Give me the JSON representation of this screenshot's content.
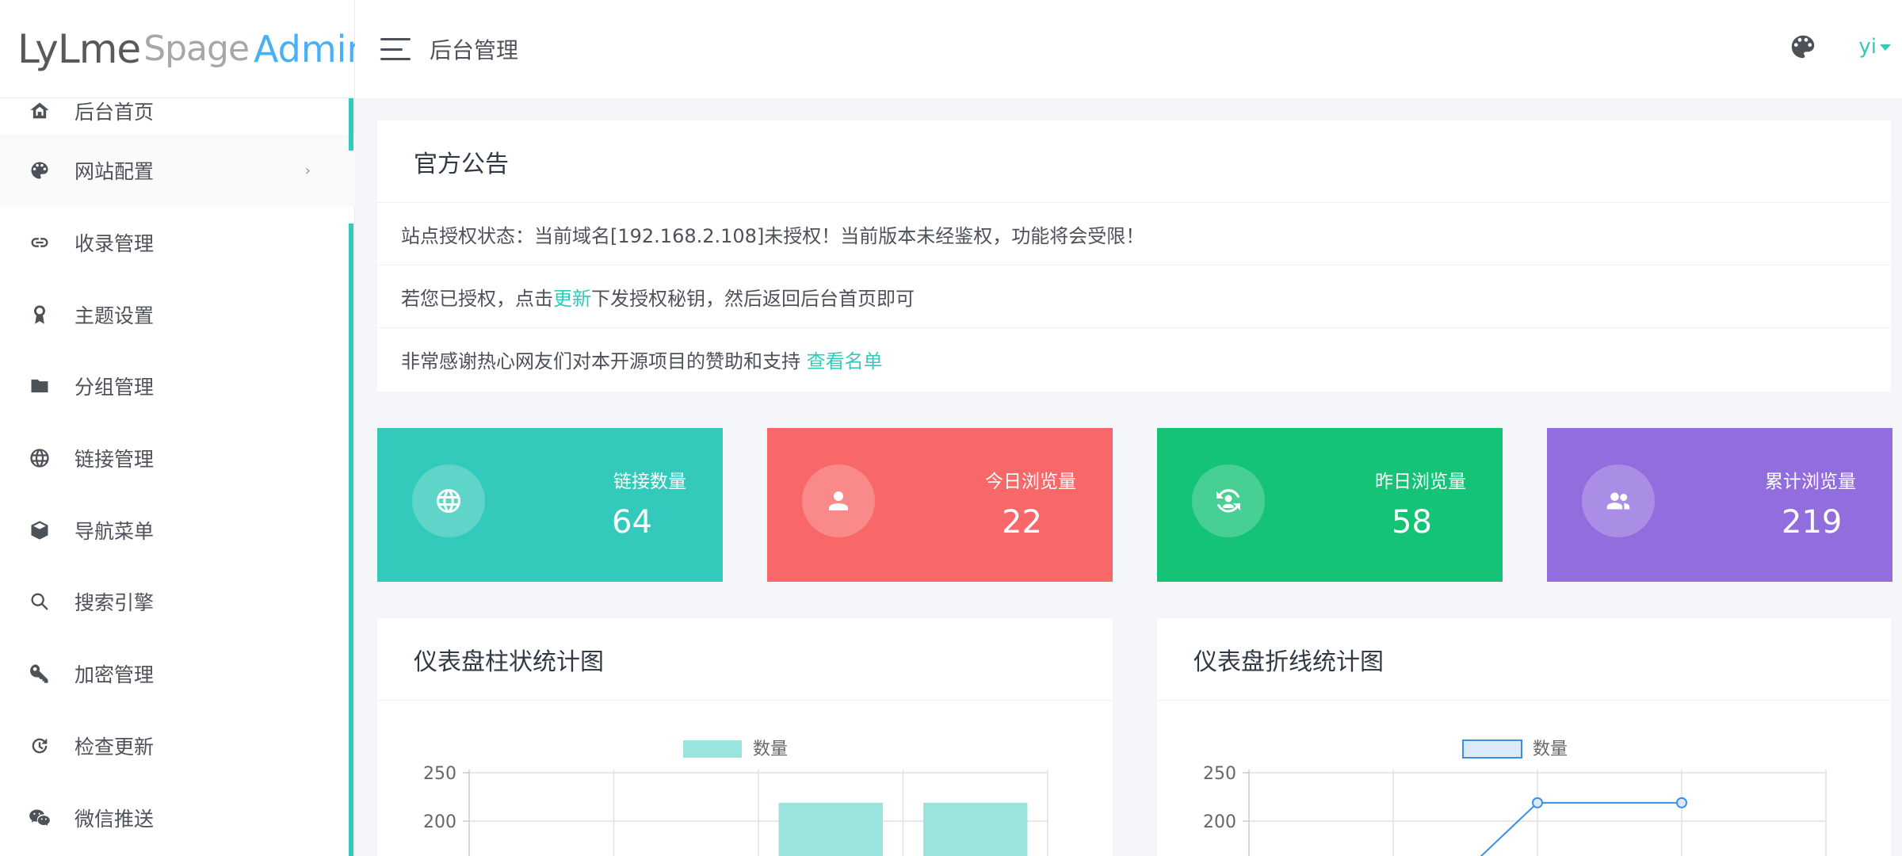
{
  "logo": {
    "part1": "LyLme",
    "part2": "Spage",
    "part3": "Admin"
  },
  "header": {
    "title": "后台管理",
    "user": "yi"
  },
  "sidebar": {
    "items": [
      {
        "label": "后台首页",
        "icon": "home-icon"
      },
      {
        "label": "网站配置",
        "icon": "palette-icon",
        "chevron": "›"
      },
      {
        "label": "收录管理",
        "icon": "link-icon"
      },
      {
        "label": "主题设置",
        "icon": "award-icon"
      },
      {
        "label": "分组管理",
        "icon": "folder-icon"
      },
      {
        "label": "链接管理",
        "icon": "globe-icon"
      },
      {
        "label": "导航菜单",
        "icon": "cube-icon"
      },
      {
        "label": "搜索引擎",
        "icon": "search-icon"
      },
      {
        "label": "加密管理",
        "icon": "key-icon"
      },
      {
        "label": "检查更新",
        "icon": "refresh-icon"
      },
      {
        "label": "微信推送",
        "icon": "wechat-icon"
      }
    ]
  },
  "notice": {
    "title": "官方公告",
    "line1": "站点授权状态：当前域名[192.168.2.108]未授权！当前版本未经鉴权，功能将会受限！",
    "line2_pre": "若您已授权，点击",
    "line2_link": "更新",
    "line2_post": "下发授权秘钥，然后返回后台首页即可",
    "line3_pre": "非常感谢热心网友们对本开源项目的赞助和支持 ",
    "line3_link": "查看名单"
  },
  "stats": [
    {
      "label": "链接数量",
      "value": "64",
      "color": "#33cabb",
      "icon": "globe-icon"
    },
    {
      "label": "今日浏览量",
      "value": "22",
      "color": "#f96868",
      "icon": "user-icon"
    },
    {
      "label": "昨日浏览量",
      "value": "58",
      "color": "#15c377",
      "icon": "user-sync-icon"
    },
    {
      "label": "累计浏览量",
      "value": "219",
      "color": "#926dde",
      "icon": "users-icon"
    }
  ],
  "chart_data": [
    {
      "type": "bar",
      "title": "仪表盘柱状统计图",
      "series": [
        {
          "name": "数量",
          "values": [
            null,
            null,
            219,
            219
          ]
        }
      ],
      "categories": [
        "",
        "",
        "",
        ""
      ],
      "yticks": [
        "250",
        "200"
      ],
      "ylim": [
        0,
        250
      ],
      "color": "#33cabb"
    },
    {
      "type": "line",
      "title": "仪表盘折线统计图",
      "series": [
        {
          "name": "数量",
          "values": [
            null,
            null,
            219,
            219
          ]
        }
      ],
      "categories": [
        "",
        "",
        "",
        ""
      ],
      "yticks": [
        "250",
        "200"
      ],
      "ylim": [
        0,
        250
      ],
      "color": "#3a8ee6"
    }
  ]
}
